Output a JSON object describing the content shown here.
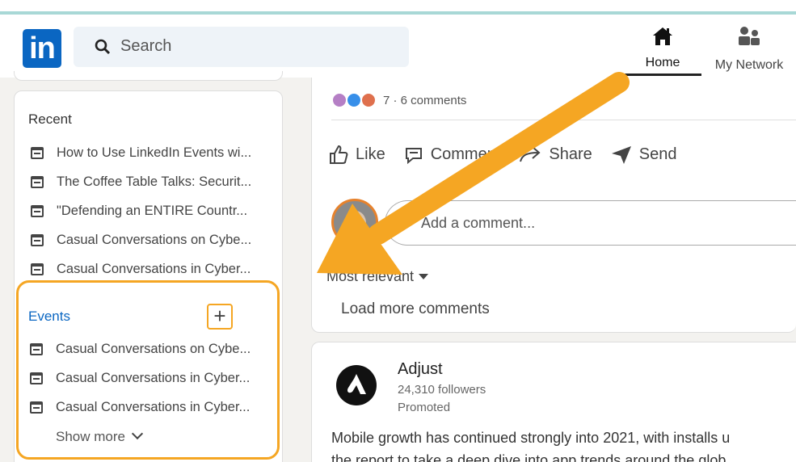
{
  "app": {
    "logo_text": "in"
  },
  "search": {
    "placeholder": "Search"
  },
  "nav": [
    {
      "label": "Home",
      "icon": "home-icon"
    },
    {
      "label": "My Network",
      "icon": "network-icon"
    }
  ],
  "sidebar": {
    "recent_title": "Recent",
    "recent": [
      "How to Use LinkedIn Events wi...",
      "The Coffee Table Talks: Securit...",
      "\"Defending an ENTIRE Countr...",
      "Casual Conversations on Cybe...",
      "Casual Conversations in Cyber..."
    ],
    "events_title": "Events",
    "add_symbol": "+",
    "events": [
      "Casual Conversations on Cybe...",
      "Casual Conversations in Cyber...",
      "Casual Conversations in Cyber..."
    ],
    "show_more": "Show more"
  },
  "post": {
    "reaction_summary": "7 · 6 comments",
    "actions": [
      "Like",
      "Comment",
      "Share",
      "Send"
    ],
    "comment_placeholder": "Add a comment...",
    "sort_label": "Most relevant",
    "load_more": "Load more comments"
  },
  "ad": {
    "name": "Adjust",
    "followers": "24,310 followers",
    "promoted": "Promoted",
    "text_line1": "Mobile growth has continued strongly into 2021, with installs u",
    "text_line2": "the report to take a deep dive into app trends around the glob"
  },
  "colors": {
    "brand": "#0a66c2",
    "highlight": "#f5a623"
  }
}
